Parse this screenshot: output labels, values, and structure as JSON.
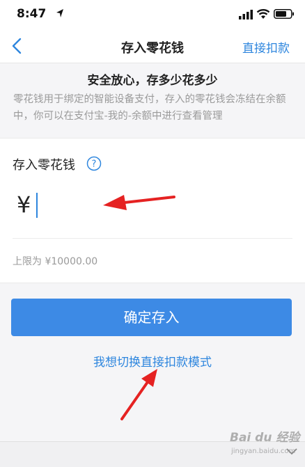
{
  "status_bar": {
    "time": "8:47"
  },
  "nav": {
    "title": "存入零花钱",
    "right_action": "直接扣款"
  },
  "notice": {
    "title": "安全放心，存多少花多少",
    "description": "零花钱用于绑定的智能设备支付，存入的零花钱会冻结在余额中，你可以在支付宝-我的-余额中进行查看管理"
  },
  "deposit": {
    "label": "存入零花钱",
    "currency_symbol": "¥",
    "amount_value": "",
    "limit_text": "上限为 ¥10000.00"
  },
  "actions": {
    "confirm_label": "确定存入",
    "switch_mode_label": "我想切换直接扣款模式"
  },
  "watermark": {
    "brand": "Bai du 经验",
    "url": "jingyan.baidu.com"
  },
  "colors": {
    "accent": "#2e86de",
    "button": "#3d8ae5",
    "annotation": "#e52222"
  },
  "icons": [
    "location-arrow-icon",
    "signal-icon",
    "wifi-icon",
    "battery-icon",
    "back-chevron-icon",
    "question-mark-icon",
    "chevron-down-icon"
  ]
}
